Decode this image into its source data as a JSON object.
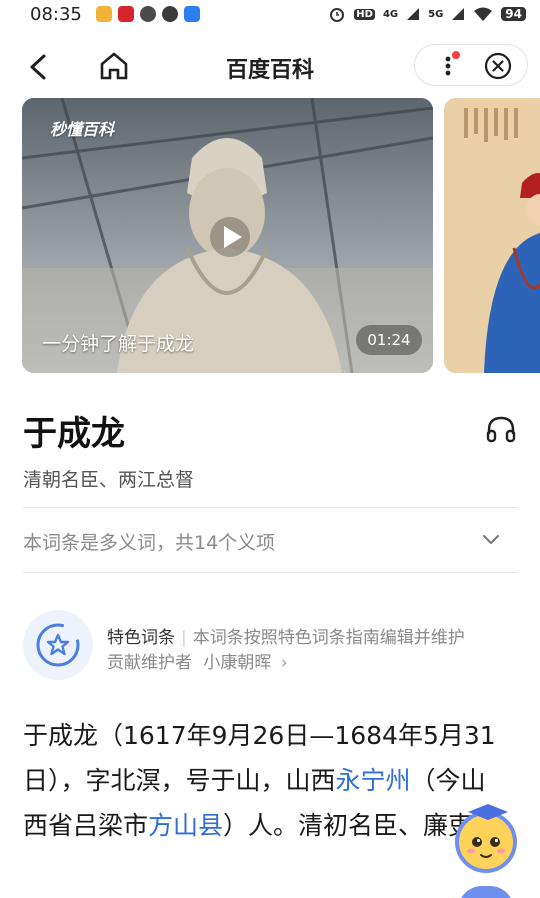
{
  "status": {
    "time": "08:35",
    "network_labels": [
      "HD",
      "4G",
      "5G"
    ],
    "battery": "94"
  },
  "nav": {
    "title": "百度百科"
  },
  "video": {
    "brand": "秒懂百科",
    "caption": "一分钟了解于成龙",
    "duration": "01:24"
  },
  "entry": {
    "title": "于成龙",
    "subtitle": "清朝名臣、两江总督",
    "polysemy": "本词条是多义词，共14个义项"
  },
  "feature": {
    "label": "特色词条",
    "description": "本词条按照特色词条指南编辑并维护",
    "contributor_prefix": "贡献维护者",
    "contributor": "小康朝晖",
    "arrow": "›"
  },
  "paragraph": {
    "part1": "于成龙（1617年9月26日—1684年5月31日），字北溟，号于山，山西",
    "link1": "永宁州",
    "part2": "（今山西省吕梁市",
    "link2": "方山县",
    "part3": "）人。清初名臣、廉吏。"
  },
  "colors": {
    "link": "#2f6fd6",
    "notification_dot": "#ff3b3b",
    "accent_blue": "#6f8ff0"
  }
}
